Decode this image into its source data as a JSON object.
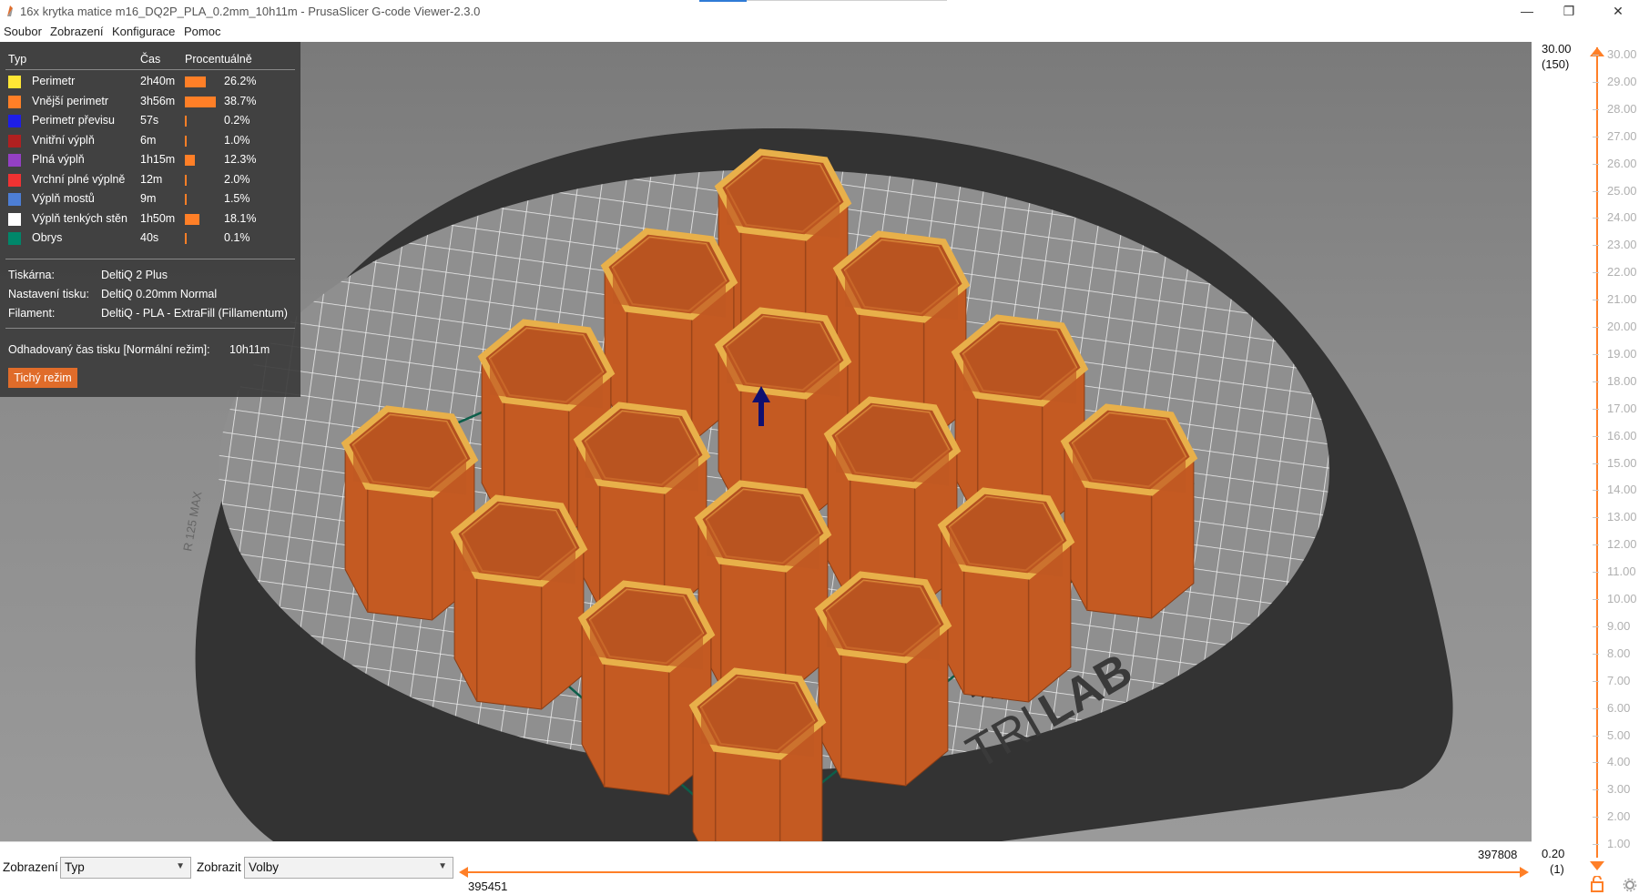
{
  "window": {
    "title": "16x krytka matice m16_DQ2P_PLA_0.2mm_10h11m - PrusaSlicer G-code Viewer-2.3.0",
    "minimize_glyph": "—",
    "restore_glyph": "❐",
    "close_glyph": "✕"
  },
  "menu": [
    "Soubor",
    "Zobrazení",
    "Konfigurace",
    "Pomoc"
  ],
  "legend": {
    "headers": {
      "type": "Typ",
      "time": "Čas",
      "percent": "Procentuálně"
    },
    "items": [
      {
        "label": "Perimetr",
        "time": "2h40m",
        "percent": "26.2%",
        "fraction": 0.262,
        "color": "#ffe635"
      },
      {
        "label": "Vnější perimetr",
        "time": "3h56m",
        "percent": "38.7%",
        "fraction": 0.387,
        "color": "#ff7f27"
      },
      {
        "label": "Perimetr převisu",
        "time": "57s",
        "percent": "0.2%",
        "fraction": 0.002,
        "color": "#1e1ee6"
      },
      {
        "label": "Vnitřní výplň",
        "time": "6m",
        "percent": "1.0%",
        "fraction": 0.01,
        "color": "#b02020"
      },
      {
        "label": "Plná výplň",
        "time": "1h15m",
        "percent": "12.3%",
        "fraction": 0.123,
        "color": "#9340c4"
      },
      {
        "label": "Vrchní plné výplně",
        "time": "12m",
        "percent": "2.0%",
        "fraction": 0.02,
        "color": "#f03232"
      },
      {
        "label": "Výplň mostů",
        "time": "9m",
        "percent": "1.5%",
        "fraction": 0.015,
        "color": "#4d7ed4"
      },
      {
        "label": "Výplň tenkých stěn",
        "time": "1h50m",
        "percent": "18.1%",
        "fraction": 0.181,
        "color": "#ffffff"
      },
      {
        "label": "Obrys",
        "time": "40s",
        "percent": "0.1%",
        "fraction": 0.001,
        "color": "#00876a"
      }
    ],
    "printer_label": "Tiskárna:",
    "printer_value": "DeltiQ 2 Plus",
    "print_settings_label": "Nastavení tisku:",
    "print_settings_value": "DeltiQ 0.20mm Normal",
    "filament_label": "Filament:",
    "filament_value": "DeltiQ - PLA - ExtraFill (Fillamentum)",
    "estimated_time_label": "Odhadovaný čas tisku [Normální režim]:",
    "estimated_time_value": "10h11m",
    "silent_mode_button": "Tichý režim"
  },
  "bed": {
    "logo_text_light": "TRI",
    "logo_text_bold": "LAB",
    "bed_label": "R 125 MAX",
    "object_color": "#c45a22",
    "object_edge_color": "#e8b04a",
    "skirt_color": "#0d5e4a"
  },
  "vertical_slider": {
    "top_value": "30.00",
    "top_layer": "(150)",
    "bottom_value": "0.20",
    "bottom_layer": "(1)",
    "ticks": [
      "30.00",
      "29.00",
      "28.00",
      "27.00",
      "26.00",
      "25.00",
      "24.00",
      "23.00",
      "22.00",
      "21.00",
      "20.00",
      "19.00",
      "18.00",
      "17.00",
      "16.00",
      "15.00",
      "14.00",
      "13.00",
      "12.00",
      "11.00",
      "10.00",
      "9.00",
      "8.00",
      "7.00",
      "6.00",
      "5.00",
      "4.00",
      "3.00",
      "2.00",
      "1.00"
    ],
    "accent_color": "#ff7f27"
  },
  "bottom_bar": {
    "view_label": "Zobrazení",
    "view_value": "Typ",
    "show_label": "Zobrazit",
    "show_value": "Volby",
    "moves_max": "397808",
    "moves_min": "395451"
  }
}
